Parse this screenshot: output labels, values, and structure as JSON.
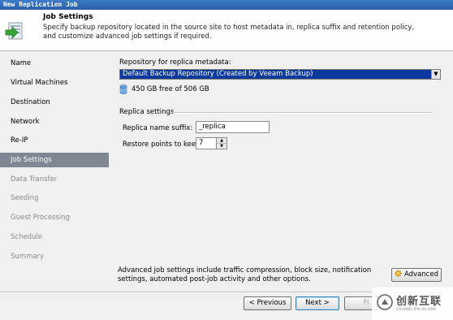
{
  "window": {
    "title": "New Replication Job"
  },
  "header": {
    "title": "Job Settings",
    "description": "Specify backup repository located in the source site to host metadata in, replica suffix and retention policy, and customize advanced job settings if required."
  },
  "sidebar": {
    "items": [
      {
        "label": "Name",
        "state": "enabled"
      },
      {
        "label": "Virtual Machines",
        "state": "enabled"
      },
      {
        "label": "Destination",
        "state": "enabled"
      },
      {
        "label": "Network",
        "state": "enabled"
      },
      {
        "label": "Re-IP",
        "state": "enabled"
      },
      {
        "label": "Job Settings",
        "state": "active"
      },
      {
        "label": "Data Transfer",
        "state": "disabled"
      },
      {
        "label": "Seeding",
        "state": "disabled"
      },
      {
        "label": "Guest Processing",
        "state": "disabled"
      },
      {
        "label": "Schedule",
        "state": "disabled"
      },
      {
        "label": "Summary",
        "state": "disabled"
      }
    ]
  },
  "repository": {
    "label": "Repository for replica metadata:",
    "selected": "Default Backup Repository (Created by Veeam Backup)",
    "free_space": "450 GB free of 506 GB"
  },
  "replica_settings": {
    "group_label": "Replica settings",
    "suffix_label": "Replica name suffix:",
    "suffix_value": "_replica",
    "restore_points_label": "Restore points to keep:",
    "restore_points_value": "7"
  },
  "advanced": {
    "description": "Advanced job settings include traffic compression, block size, notification settings, automated post-job activity and other options.",
    "button_label": "Advanced"
  },
  "footer": {
    "previous_label": "< Previous",
    "next_label": "Next >",
    "finish_label": "Fi"
  },
  "watermark": {
    "cn_text": "创新互联",
    "en_text": "CHUANG XIN HU LIAN"
  },
  "colors": {
    "selection": "#0b3a9c",
    "active_nav": "#7e8792",
    "titlebar": "#2a5fa8"
  }
}
